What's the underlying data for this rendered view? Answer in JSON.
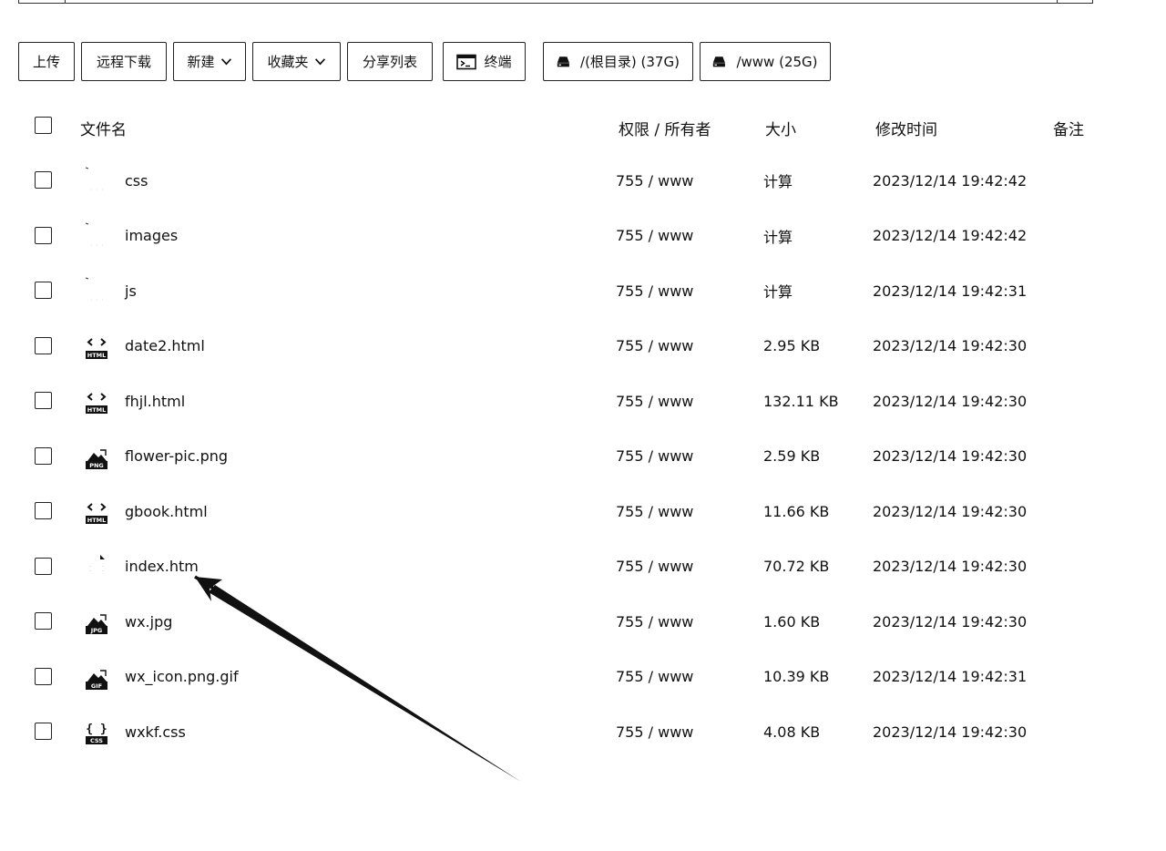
{
  "toolbar": {
    "upload": "上传",
    "remote_download": "远程下载",
    "new": "新建",
    "favorites": "收藏夹",
    "share_list": "分享列表",
    "terminal": "终端",
    "disk_root": "/(根目录) (37G)",
    "disk_www": "/www (25G)"
  },
  "table": {
    "headers": {
      "name": "文件名",
      "permission": "权限 / 所有者",
      "size": "大小",
      "modified": "修改时间",
      "note": "备注"
    },
    "rows": [
      {
        "icon": "folder-icon",
        "name": "css",
        "permission": "755 / www",
        "size": "计算",
        "modified": "2023/12/14 19:42:42"
      },
      {
        "icon": "folder-icon",
        "name": "images",
        "permission": "755 / www",
        "size": "计算",
        "modified": "2023/12/14 19:42:42"
      },
      {
        "icon": "folder-icon",
        "name": "js",
        "permission": "755 / www",
        "size": "计算",
        "modified": "2023/12/14 19:42:31"
      },
      {
        "icon": "html-file-icon",
        "name": "date2.html",
        "permission": "755 / www",
        "size": "2.95 KB",
        "modified": "2023/12/14 19:42:30"
      },
      {
        "icon": "html-file-icon",
        "name": "fhjl.html",
        "permission": "755 / www",
        "size": "132.11 KB",
        "modified": "2023/12/14 19:42:30"
      },
      {
        "icon": "png-file-icon",
        "name": "flower-pic.png",
        "permission": "755 / www",
        "size": "2.59 KB",
        "modified": "2023/12/14 19:42:30"
      },
      {
        "icon": "html-file-icon",
        "name": "gbook.html",
        "permission": "755 / www",
        "size": "11.66 KB",
        "modified": "2023/12/14 19:42:30"
      },
      {
        "icon": "generic-file-icon",
        "name": "index.htm",
        "permission": "755 / www",
        "size": "70.72 KB",
        "modified": "2023/12/14 19:42:30"
      },
      {
        "icon": "jpg-file-icon",
        "name": "wx.jpg",
        "permission": "755 / www",
        "size": "1.60 KB",
        "modified": "2023/12/14 19:42:30"
      },
      {
        "icon": "gif-file-icon",
        "name": "wx_icon.png.gif",
        "permission": "755 / www",
        "size": "10.39 KB",
        "modified": "2023/12/14 19:42:31"
      },
      {
        "icon": "css-file-icon",
        "name": "wxkf.css",
        "permission": "755 / www",
        "size": "4.08 KB",
        "modified": "2023/12/14 19:42:30"
      }
    ]
  },
  "icon_labels": {
    "html": "HTML",
    "png": "PNG",
    "jpg": "JPG",
    "gif": "GIF",
    "css": "CSS"
  }
}
